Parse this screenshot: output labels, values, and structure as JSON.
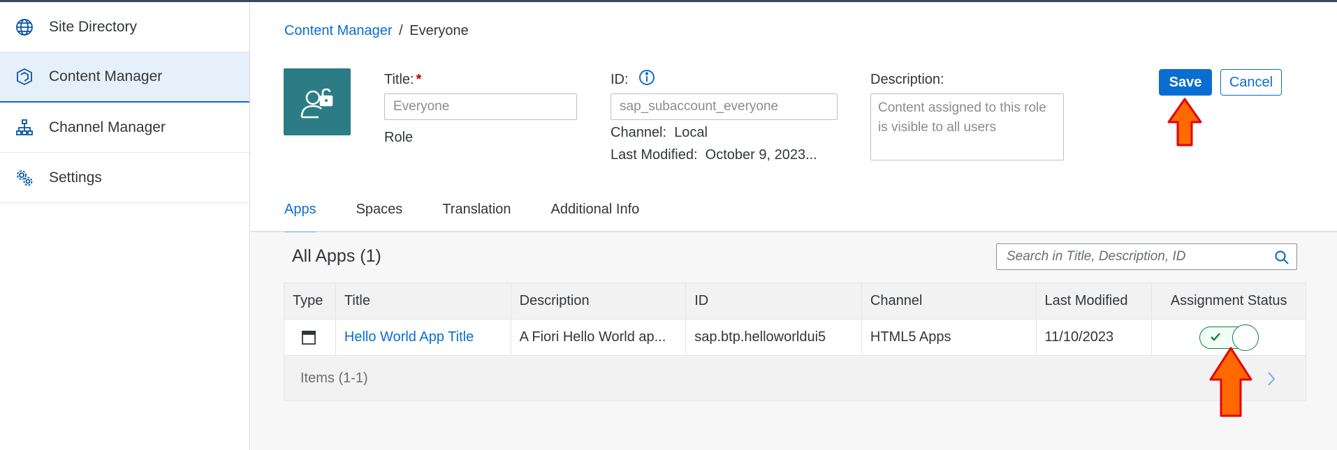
{
  "sidebar": {
    "items": [
      {
        "label": "Site Directory",
        "icon": "globe-icon"
      },
      {
        "label": "Content Manager",
        "icon": "cube-icon",
        "active": true
      },
      {
        "label": "Channel Manager",
        "icon": "hierarchy-icon"
      },
      {
        "label": "Settings",
        "icon": "gears-icon"
      }
    ]
  },
  "breadcrumb": {
    "link": "Content Manager",
    "separator": "/",
    "current": "Everyone"
  },
  "role": {
    "title_label": "Title:",
    "title_placeholder": "Everyone",
    "subtitle": "Role",
    "id_label": "ID:",
    "id_placeholder": "sap_subaccount_everyone",
    "channel_label": "Channel:",
    "channel_value": "Local",
    "modified_label": "Last Modified:",
    "modified_value": "October 9, 2023...",
    "description_label": "Description:",
    "description_placeholder": "Content assigned to this role is visible to all users"
  },
  "buttons": {
    "save": "Save",
    "cancel": "Cancel"
  },
  "tabs": [
    "Apps",
    "Spaces",
    "Translation",
    "Additional Info"
  ],
  "apps": {
    "title": "All Apps (1)",
    "search_placeholder": "Search in Title, Description, ID",
    "columns": [
      "Type",
      "Title",
      "Description",
      "ID",
      "Channel",
      "Last Modified",
      "Assignment Status"
    ],
    "rows": [
      {
        "title": "Hello World App Title",
        "description": "A Fiori Hello World ap...",
        "id": "sap.btp.helloworldui5",
        "channel": "HTML5 Apps",
        "modified": "11/10/2023",
        "assigned": true
      }
    ],
    "footer": "Items (1-1)"
  },
  "colors": {
    "accent": "#0a6ed1",
    "role_tile": "#2b7c85",
    "success": "#107e3e",
    "arrow": "#ff6a00"
  }
}
